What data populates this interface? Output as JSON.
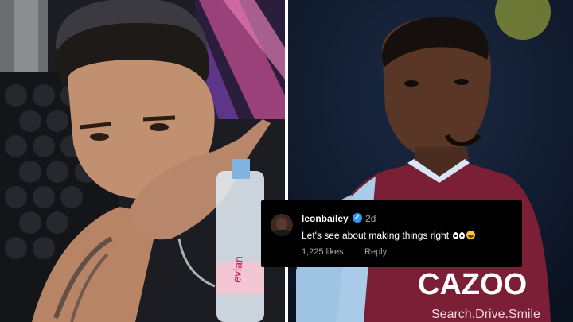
{
  "comment": {
    "username": "leonbailey",
    "verified_icon": "verified-check-icon",
    "age": "2d",
    "text": "Let's see about making things right",
    "emojis": [
      "eyes",
      "tears-of-joy"
    ],
    "likes": "1,225 likes",
    "reply_label": "Reply"
  },
  "photos": {
    "left_bottle_brand": "evian",
    "right_shirt_sponsor": "CAZOO",
    "right_shirt_slogan": "Search.Drive.Smile"
  },
  "colors": {
    "comment_bg": "#000000",
    "verified_blue": "#3897f0",
    "shirt_claret": "#7b1f36",
    "shirt_blue": "#a9cbe8"
  }
}
